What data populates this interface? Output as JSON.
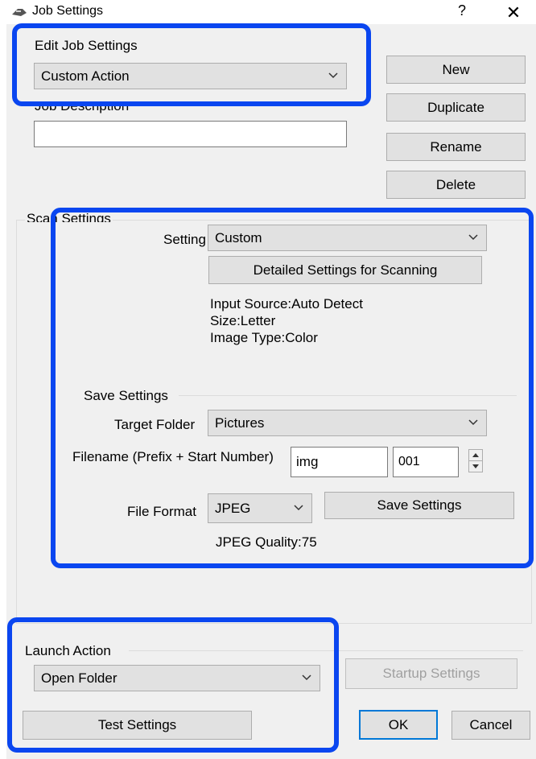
{
  "window": {
    "title": "Job Settings",
    "help_glyph": "?",
    "close_glyph": "✕"
  },
  "edit_job": {
    "label": "Edit Job Settings",
    "selected": "Custom Action",
    "job_description_label": "Job Description",
    "job_description_value": ""
  },
  "job_buttons": {
    "new": "New",
    "duplicate": "Duplicate",
    "rename": "Rename",
    "delete": "Delete"
  },
  "scan_settings": {
    "label": "Scan Settings",
    "setting_label": "Setting",
    "setting_value": "Custom",
    "detailed_button": "Detailed Settings for Scanning",
    "info": [
      "Input Source:Auto Detect",
      "Size:Letter",
      "Image Type:Color"
    ]
  },
  "save_settings": {
    "label": "Save Settings",
    "target_folder_label": "Target Folder",
    "target_folder_value": "Pictures",
    "filename_label": "Filename (Prefix + Start Number)",
    "prefix_value": "img",
    "start_number_value": "001",
    "file_format_label": "File Format",
    "file_format_value": "JPEG",
    "save_button": "Save Settings",
    "jpeg_quality": "JPEG Quality:75"
  },
  "launch_action": {
    "label": "Launch Action",
    "selected": "Open Folder",
    "startup_button": "Startup Settings",
    "test_button": "Test Settings"
  },
  "dialog_buttons": {
    "ok": "OK",
    "cancel": "Cancel"
  },
  "colors": {
    "highlight": "#0a46f0",
    "dialog_bg": "#f0f0f0",
    "button_bg": "#e1e1e1"
  }
}
